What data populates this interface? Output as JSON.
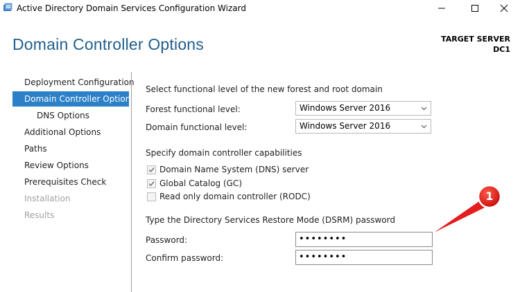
{
  "window": {
    "title": "Active Directory Domain Services Configuration Wizard",
    "minimize_glyph": "—",
    "maximize_glyph": "☐",
    "close_glyph": "✕"
  },
  "header": {
    "page_title": "Domain Controller Options",
    "target_label": "TARGET SERVER",
    "target_value": "DC1"
  },
  "sidebar": {
    "items": [
      {
        "label": "Deployment Configuration",
        "state": "normal"
      },
      {
        "label": "Domain Controller Options",
        "state": "active"
      },
      {
        "label": "DNS Options",
        "state": "sub"
      },
      {
        "label": "Additional Options",
        "state": "normal"
      },
      {
        "label": "Paths",
        "state": "normal"
      },
      {
        "label": "Review Options",
        "state": "normal"
      },
      {
        "label": "Prerequisites Check",
        "state": "normal"
      },
      {
        "label": "Installation",
        "state": "disabled"
      },
      {
        "label": "Results",
        "state": "disabled"
      }
    ]
  },
  "main": {
    "functional_heading": "Select functional level of the new forest and root domain",
    "forest_label": "Forest functional level:",
    "forest_value": "Windows Server 2016",
    "domain_label": "Domain functional level:",
    "domain_value": "Windows Server 2016",
    "capabilities_heading": "Specify domain controller capabilities",
    "capabilities": [
      {
        "label": "Domain Name System (DNS) server",
        "checked": true
      },
      {
        "label": "Global Catalog (GC)",
        "checked": true
      },
      {
        "label": "Read only domain controller (RODC)",
        "checked": false
      }
    ],
    "dsrm_heading": "Type the Directory Services Restore Mode (DSRM) password",
    "password_label": "Password:",
    "password_value": "••••••••",
    "confirm_label": "Confirm password:",
    "confirm_value": "••••••••"
  },
  "annotation": {
    "number": "1",
    "color": "#e41e1e"
  },
  "colors": {
    "accent": "#2b80c8",
    "title_blue": "#1f5e8e"
  }
}
